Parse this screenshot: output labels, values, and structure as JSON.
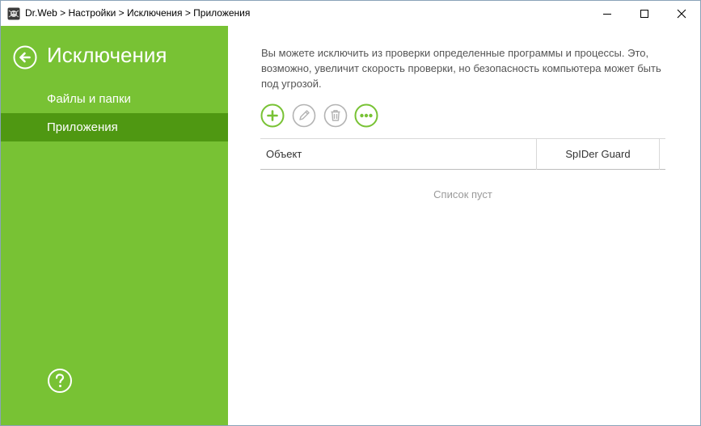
{
  "window": {
    "title": "Dr.Web > Настройки > Исключения > Приложения",
    "app_icon": "drweb-spider-icon"
  },
  "sidebar": {
    "title": "Исключения",
    "back_icon": "back-arrow-icon",
    "items": [
      {
        "label": "Файлы и папки",
        "active": false
      },
      {
        "label": "Приложения",
        "active": true
      }
    ],
    "help_icon": "help-icon"
  },
  "main": {
    "description": "Вы можете исключить из проверки определенные программы и процессы. Это, возможно, увеличит скорость проверки, но безопасность компьютера может быть под угрозой.",
    "toolbar": [
      {
        "name": "add",
        "icon": "plus-icon",
        "enabled": true
      },
      {
        "name": "edit",
        "icon": "pencil-icon",
        "enabled": false
      },
      {
        "name": "delete",
        "icon": "trash-icon",
        "enabled": false
      },
      {
        "name": "more",
        "icon": "more-icon",
        "enabled": true
      }
    ],
    "table": {
      "columns": [
        "Объект",
        "SpIDer Guard"
      ],
      "rows": [],
      "empty_text": "Список пуст"
    }
  },
  "colors": {
    "sidebar_bg": "#78c234",
    "sidebar_active": "#4f9812",
    "accent": "#78c234",
    "disabled": "#b3b3b3"
  }
}
